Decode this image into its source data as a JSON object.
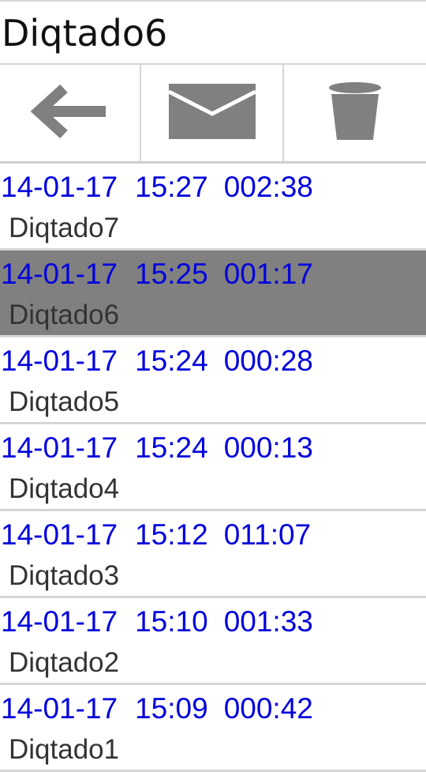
{
  "header": {
    "title": "Diqtado6"
  },
  "toolbar": {
    "buttons": [
      {
        "icon": "arrow-left-icon"
      },
      {
        "icon": "mail-icon"
      },
      {
        "icon": "trash-icon"
      }
    ],
    "icon_color": "#808080"
  },
  "recordings": [
    {
      "date": "14-01-17",
      "time": "15:27",
      "duration": "002:38",
      "name": "Diqtado7",
      "selected": false
    },
    {
      "date": "14-01-17",
      "time": "15:25",
      "duration": "001:17",
      "name": "Diqtado6",
      "selected": true
    },
    {
      "date": "14-01-17",
      "time": "15:24",
      "duration": "000:28",
      "name": "Diqtado5",
      "selected": false
    },
    {
      "date": "14-01-17",
      "time": "15:24",
      "duration": "000:13",
      "name": "Diqtado4",
      "selected": false
    },
    {
      "date": "14-01-17",
      "time": "15:12",
      "duration": "011:07",
      "name": "Diqtado3",
      "selected": false
    },
    {
      "date": "14-01-17",
      "time": "15:10",
      "duration": "001:33",
      "name": "Diqtado2",
      "selected": false
    },
    {
      "date": "14-01-17",
      "time": "15:09",
      "duration": "000:42",
      "name": "Diqtado1",
      "selected": false
    }
  ],
  "colors": {
    "meta_text": "#0000dd",
    "name_text": "#333333",
    "selected_row": "#808080"
  }
}
